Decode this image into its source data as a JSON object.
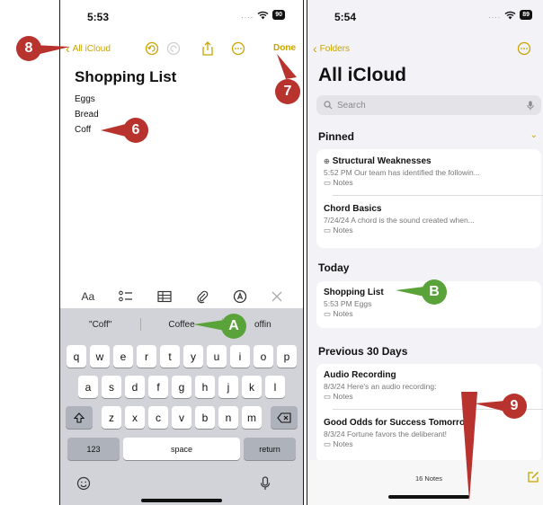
{
  "left": {
    "time": "5:53",
    "battery": "90",
    "back_label": "All iCloud",
    "done_label": "Done",
    "title": "Shopping List",
    "lines": [
      "Eggs",
      "Bread",
      "Coff"
    ],
    "format_text_label": "Aa",
    "suggestions": [
      "\"Coff\"",
      "Coffee",
      "offin"
    ],
    "rows": [
      [
        "q",
        "w",
        "e",
        "r",
        "t",
        "y",
        "u",
        "i",
        "o",
        "p"
      ],
      [
        "a",
        "s",
        "d",
        "f",
        "g",
        "h",
        "j",
        "k",
        "l"
      ],
      [
        "z",
        "x",
        "c",
        "v",
        "b",
        "n",
        "m"
      ]
    ],
    "numbers_key": "123",
    "space_key": "space",
    "return_key": "return"
  },
  "right": {
    "time": "5:54",
    "battery": "89",
    "back_label": "Folders",
    "title": "All iCloud",
    "search_placeholder": "Search",
    "pinned_header": "Pinned",
    "pinned": [
      {
        "title": "Structural Weaknesses",
        "subtitle": "5:52 PM  Our team has identified the followin...",
        "folder": "Notes"
      },
      {
        "title": "Chord Basics",
        "subtitle": "7/24/24  A chord is the sound created when...",
        "folder": "Notes"
      }
    ],
    "today_header": "Today",
    "today": [
      {
        "title": "Shopping List",
        "subtitle": "5:53 PM  Eggs",
        "folder": "Notes"
      }
    ],
    "prev_header": "Previous 30 Days",
    "previous": [
      {
        "title": "Audio Recording",
        "subtitle": "8/3/24  Here's an audio recording:",
        "folder": "Notes"
      },
      {
        "title": "Good Odds for Success Tomorrow",
        "subtitle": "8/3/24  Fortune favors the deliberant!",
        "folder": "Notes"
      }
    ],
    "count_label": "16 Notes"
  },
  "callouts": {
    "c8": "8",
    "c7": "7",
    "c6": "6",
    "cA": "A",
    "cB": "B",
    "c9": "9"
  },
  "colors": {
    "accent": "#c9a400",
    "callout_red": "#b8322e",
    "callout_green": "#5aa23a"
  }
}
